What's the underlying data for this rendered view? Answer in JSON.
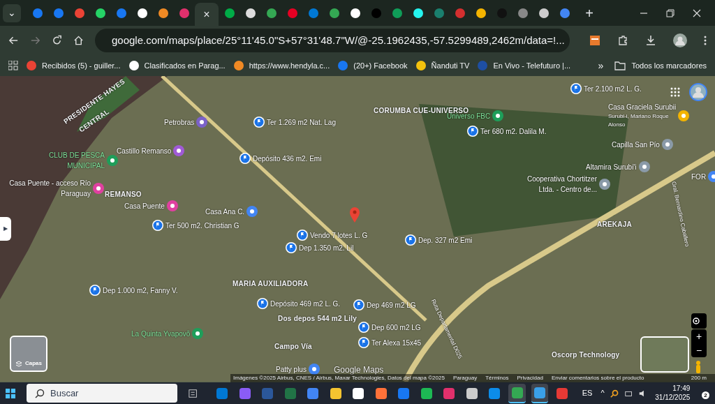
{
  "tab_strip": {
    "menu_glyph": "⌄",
    "close_glyph": "×",
    "new_tab_glyph": "+",
    "tabs": [
      {
        "selected": false,
        "color": "#1877f2"
      },
      {
        "selected": false,
        "color": "#1877f2"
      },
      {
        "selected": false,
        "color": "#ea4335"
      },
      {
        "selected": false,
        "color": "#25d366"
      },
      {
        "selected": false,
        "color": "#1877f2"
      },
      {
        "selected": false,
        "color": "#ffffff"
      },
      {
        "selected": false,
        "color": "#f08a24"
      },
      {
        "selected": false,
        "color": "#e1306c"
      },
      {
        "selected": true,
        "color": "#2f3b33"
      },
      {
        "selected": false,
        "color": "#00ac47"
      },
      {
        "selected": false,
        "color": "#dddddd"
      },
      {
        "selected": false,
        "color": "#34a853"
      },
      {
        "selected": false,
        "color": "#e60023"
      },
      {
        "selected": false,
        "color": "#0078d4"
      },
      {
        "selected": false,
        "color": "#34a853"
      },
      {
        "selected": false,
        "color": "#ffffff"
      },
      {
        "selected": false,
        "color": "#000000"
      },
      {
        "selected": false,
        "color": "#0f9d58"
      },
      {
        "selected": false,
        "color": "#25f4ee"
      },
      {
        "selected": false,
        "color": "#1a7f6e"
      },
      {
        "selected": false,
        "color": "#d32f2f"
      },
      {
        "selected": false,
        "color": "#f4b400"
      },
      {
        "selected": false,
        "color": "#111111"
      },
      {
        "selected": false,
        "color": "#888888"
      },
      {
        "selected": false,
        "color": "#cccccc"
      },
      {
        "selected": false,
        "color": "#4285f4"
      }
    ]
  },
  "address_bar": {
    "url": "google.com/maps/place/25°11'45.0\"S+57°31'48.7\"W/@-25.1962435,-57.5299489,2462m/data=!..."
  },
  "bookmarks": [
    {
      "label": "Recibidos (5) - guiller...",
      "color": "#ea4335"
    },
    {
      "label": "Clasificados en Parag...",
      "color": "#ffffff"
    },
    {
      "label": "https://www.hendyla.c...",
      "color": "#f08a24"
    },
    {
      "label": "(20+) Facebook",
      "color": "#1877f2"
    },
    {
      "label": "Ñanduti TV",
      "color": "#f4c20d"
    },
    {
      "label": "En Vivo - Telefuturo |...",
      "color": "#1e4fa3"
    }
  ],
  "bookmarks_more": "»",
  "all_bookmarks": "Todos los marcadores",
  "map": {
    "labels": [
      {
        "kind": "area",
        "text": "PRESIDENTE HAYES"
      },
      {
        "kind": "area",
        "text": "CENTRAL"
      },
      {
        "kind": "poi",
        "text": "Petrobras",
        "color": "#7b61c9"
      },
      {
        "kind": "pin",
        "text": "Ter 1.269 m2 Nat. Lag"
      },
      {
        "kind": "pin",
        "text": "Depósito 436 m2. Emi"
      },
      {
        "kind": "poi",
        "text": "Castillo Remanso",
        "color": "#a05ad6"
      },
      {
        "kind": "poi",
        "text": "CLUB DE PESCA MUNICIPAL",
        "color": "#1e9e5a"
      },
      {
        "kind": "poi",
        "text": "Casa Puente - acceso Río Paraguay",
        "color": "#e040a0"
      },
      {
        "kind": "area",
        "text": "REMANSO"
      },
      {
        "kind": "poi",
        "text": "Casa Puente",
        "color": "#e040a0"
      },
      {
        "kind": "poi",
        "text": "Casa Ana C.",
        "color": "#4285f4"
      },
      {
        "kind": "pin",
        "text": "Ter 500 m2. Christian G"
      },
      {
        "kind": "pin",
        "text": "Vendo 7 lotes L. G"
      },
      {
        "kind": "pin",
        "text": "Dep 1.350 m2. Lil"
      },
      {
        "kind": "area",
        "text": "CORUMBA CUE-UNIVERSO"
      },
      {
        "kind": "poi",
        "text": "Universo FBC",
        "color": "#1e9e5a"
      },
      {
        "kind": "pin",
        "text": "Ter 680 m2. Dalila M."
      },
      {
        "kind": "pin",
        "text": "Ter 2.100 m2 L. G."
      },
      {
        "kind": "poi",
        "text": "Casa Graciela Surubii",
        "color": "#f4b400",
        "subtitle": "Surubi-i, Mariano Roque Alonso"
      },
      {
        "kind": "poi",
        "text": "Capilla San Pío",
        "color": "#8a9aa8"
      },
      {
        "kind": "poi",
        "text": "Altamira Surubi'i",
        "color": "#8a9aa8"
      },
      {
        "kind": "poi",
        "text": "Cooperativa Chortitzer Ltda. - Centro de...",
        "color": "#8a9aa8"
      },
      {
        "kind": "poi",
        "text": "FOR",
        "color": "#4285f4"
      },
      {
        "kind": "area",
        "text": "AREKAJA"
      },
      {
        "kind": "pin",
        "text": "Dep. 327 m2 Emi"
      },
      {
        "kind": "area",
        "text": "MARIA AUXILIADORA"
      },
      {
        "kind": "pin",
        "text": "Dep 1.000 m2, Fanny V."
      },
      {
        "kind": "pin",
        "text": "Depósito 469 m2 L. G."
      },
      {
        "kind": "pin",
        "text": "Dep 469 m2 LG"
      },
      {
        "kind": "area",
        "text": "Dos depos 544 m2 Lily"
      },
      {
        "kind": "pin",
        "text": "Dep 600 m2 LG"
      },
      {
        "kind": "pin",
        "text": "Ter Alexa 15x45"
      },
      {
        "kind": "poi",
        "text": "La Quinta Yvapovõ",
        "color": "#1e9e5a"
      },
      {
        "kind": "area",
        "text": "Campo Vía"
      },
      {
        "kind": "poi",
        "text": "Patty plus",
        "color": "#4285f4"
      },
      {
        "kind": "road",
        "text": "Ruta Departamental D025"
      },
      {
        "kind": "road",
        "text": "Gral. Bernardino Caballero"
      },
      {
        "kind": "area",
        "text": "Oscorp Technology"
      }
    ],
    "layers_label": "Capas",
    "collapse_glyph": "▶",
    "logo": "Google Maps",
    "footer": [
      "Imágenes ©2025 Airbus, CNES / Airbus, Maxar Technologies, Datos del mapa ©2025",
      "Paraguay",
      "Términos",
      "Privacidad",
      "Enviar comentarios sobre el producto"
    ],
    "scale": "200 m",
    "zoom_in": "+",
    "zoom_out": "−"
  },
  "taskbar": {
    "search_placeholder": "Buscar",
    "apps": [
      {
        "selected": false,
        "color": "#0078d4"
      },
      {
        "selected": false,
        "color": "#8a5cf6"
      },
      {
        "selected": false,
        "color": "#2b579a"
      },
      {
        "selected": false,
        "color": "#217346"
      },
      {
        "selected": false,
        "color": "#4285f4"
      },
      {
        "selected": false,
        "color": "#f4c430"
      },
      {
        "selected": false,
        "color": "#ffffff"
      },
      {
        "selected": false,
        "color": "#ff7139"
      },
      {
        "selected": false,
        "color": "#1877f2"
      },
      {
        "selected": false,
        "color": "#1db954"
      },
      {
        "selected": false,
        "color": "#e1306c"
      },
      {
        "selected": false,
        "color": "#cccccc"
      },
      {
        "selected": false,
        "color": "#0c8ce9"
      },
      {
        "selected": true,
        "color": "#34a853"
      },
      {
        "selected": true,
        "color": "#3aa0e8"
      },
      {
        "selected": false,
        "color": "#e53935"
      }
    ],
    "language": "ES",
    "tray_chevron": "^",
    "time": "17:49",
    "date": "31/12/2025",
    "notifications": "2"
  }
}
